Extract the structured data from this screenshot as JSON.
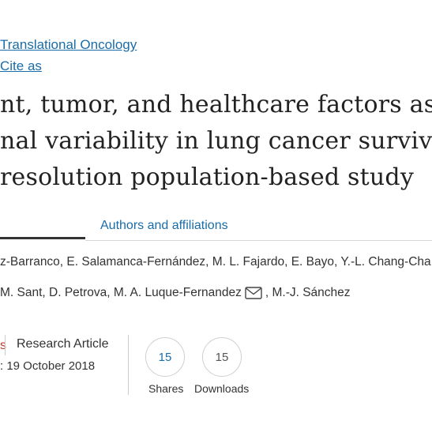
{
  "header": {
    "journal": "Translational Oncology",
    "cite": "Cite as"
  },
  "title": {
    "line1": "nt, tumor, and healthcare factors as",
    "line2": "nal variability in lung cancer surviva",
    "line3": "resolution population-based study"
  },
  "tabs": {
    "authors_affiliations": "Authors and affiliations"
  },
  "authors": {
    "line1": "z-Barranco, E. Salamanca-Fernández, M. L. Fajardo, E. Bayo, Y.-L. Chang-Cha",
    "line2_before": "M. Sant, D. Petrova, M. A. Luque-Fernandez",
    "line2_after": ", M.-J. Sánchez",
    "email_icon": "envelope-icon"
  },
  "article_info": {
    "red_fragment": "s",
    "type": "Research Article",
    "date": ": 19 October 2018"
  },
  "metrics": {
    "shares_value": "15",
    "shares_label": "Shares",
    "downloads_value": "15",
    "downloads_label": "Downloads"
  },
  "colors": {
    "link": "#1a6ca8",
    "text": "#333333",
    "accent_red": "#c0392b"
  }
}
